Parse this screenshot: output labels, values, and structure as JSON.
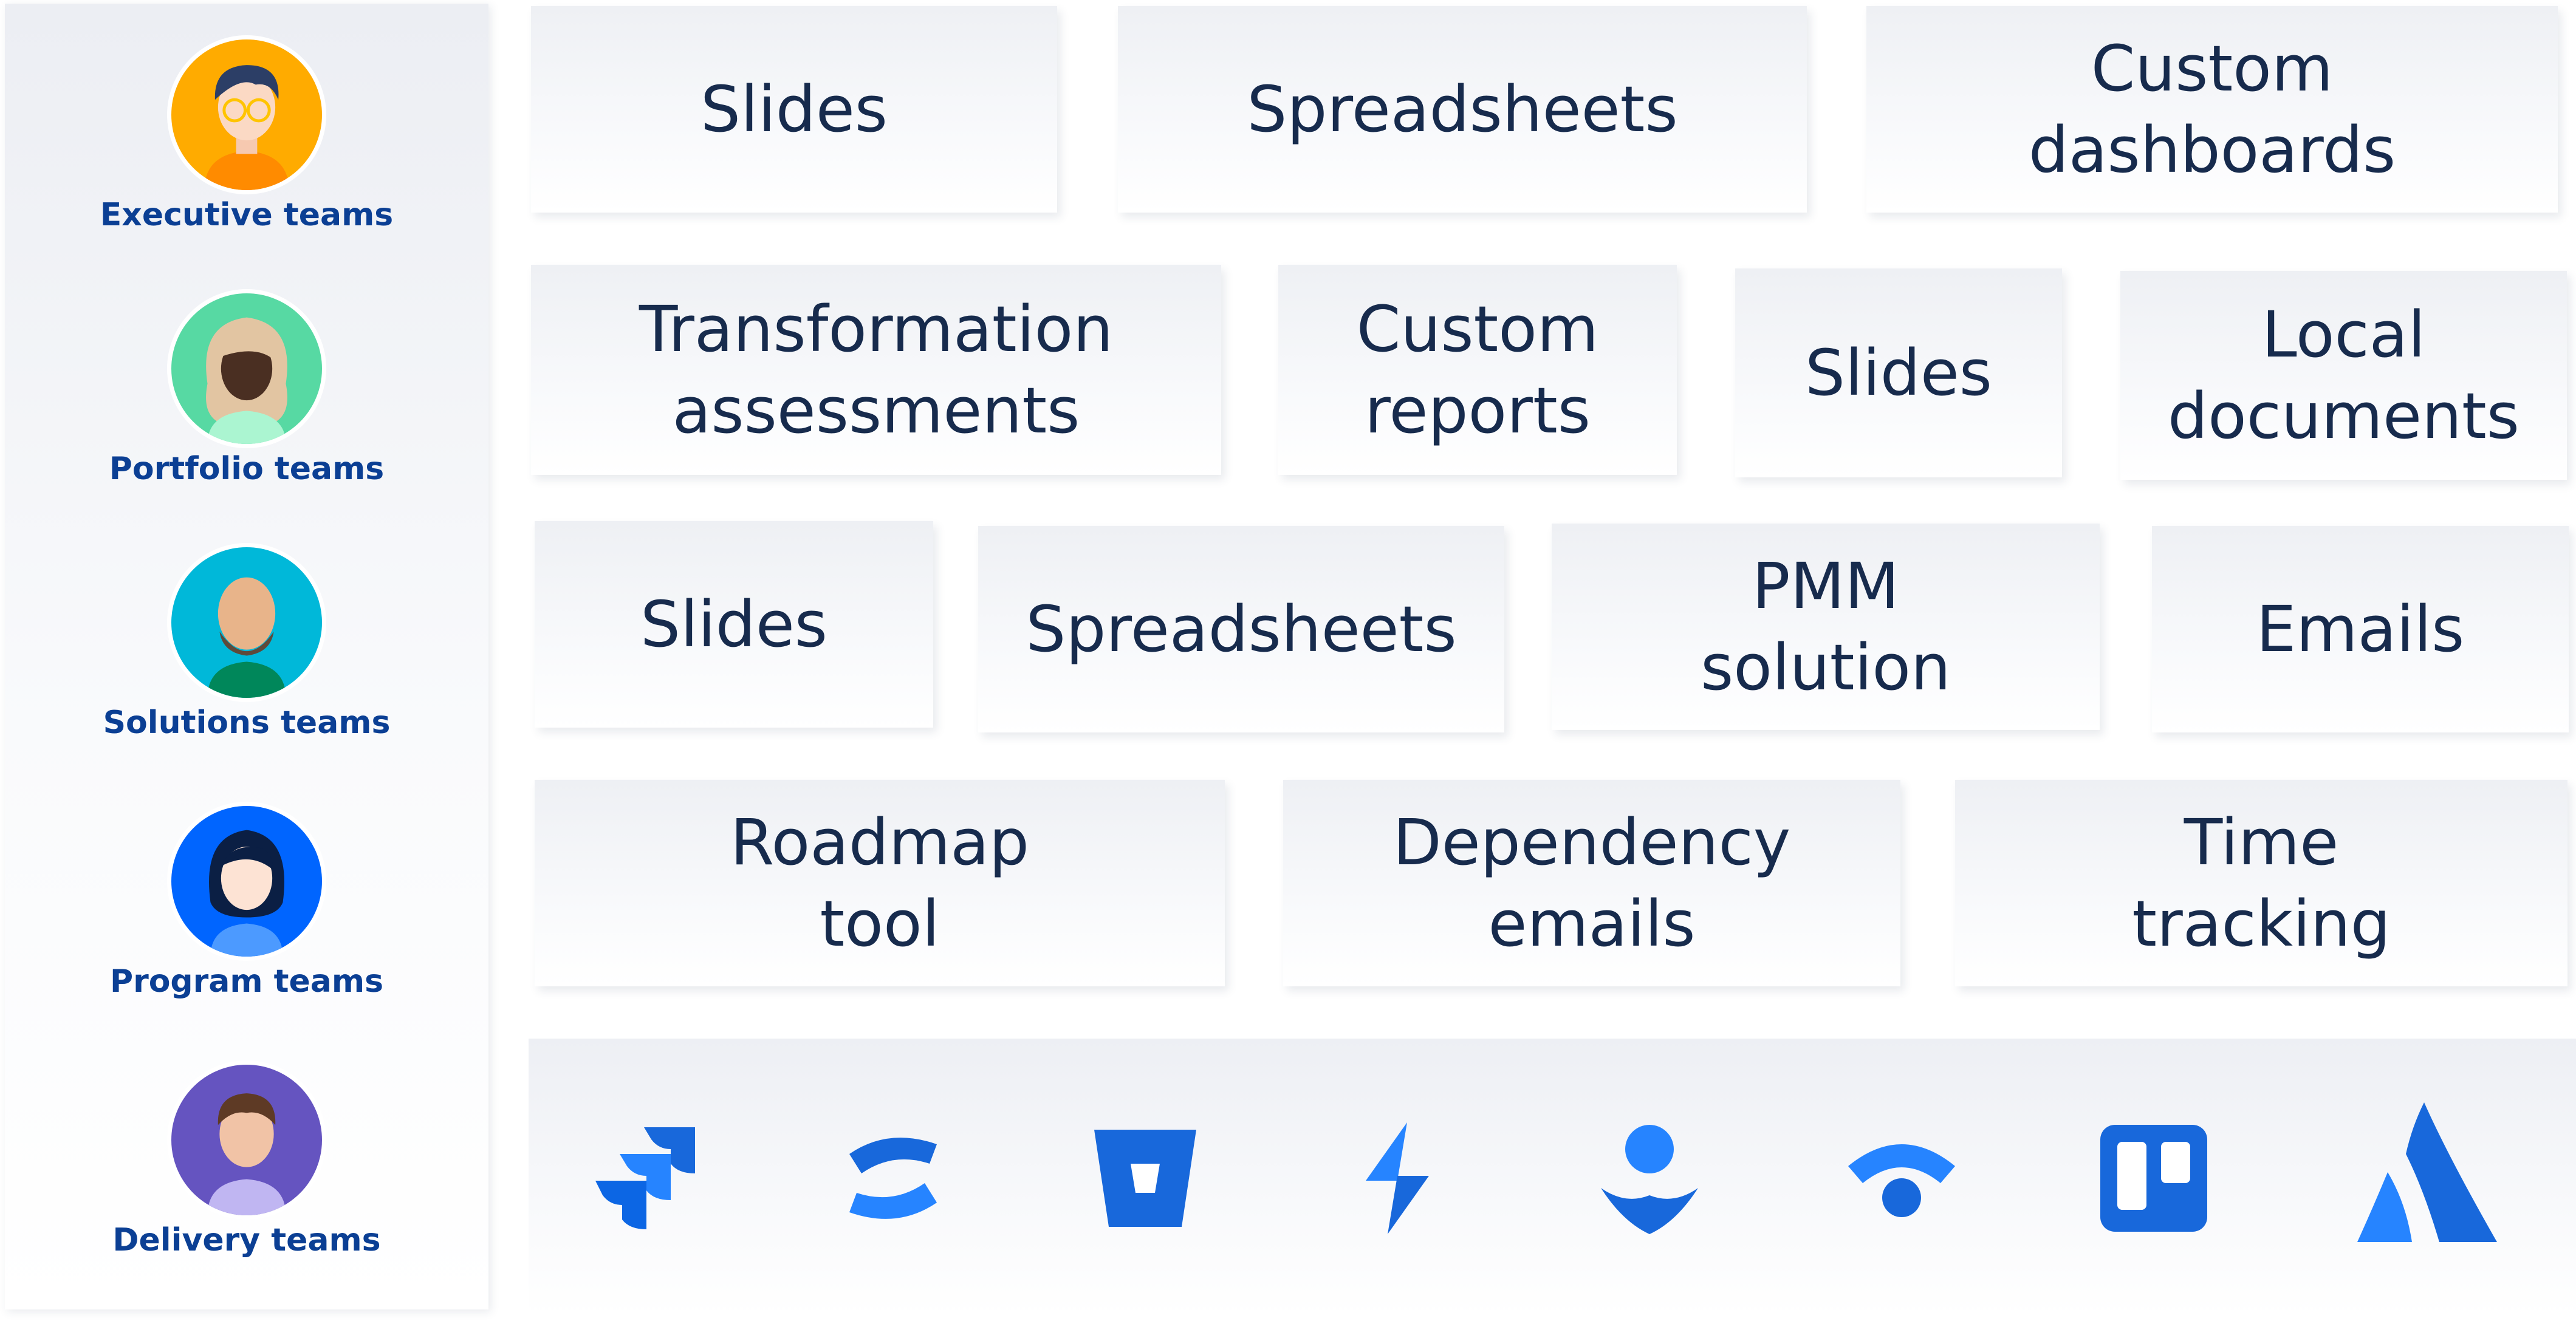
{
  "teams": [
    {
      "label": "Executive teams",
      "avatar_color": "#ffab00"
    },
    {
      "label": "Portfolio teams",
      "avatar_color": "#57d9a3"
    },
    {
      "label": "Solutions teams",
      "avatar_color": "#00b8d9"
    },
    {
      "label": "Program teams",
      "avatar_color": "#0065ff"
    },
    {
      "label": "Delivery teams",
      "avatar_color": "#6554c0"
    }
  ],
  "rows": [
    {
      "cards": [
        {
          "text": "Slides"
        },
        {
          "text": "Spreadsheets"
        },
        {
          "text": "Custom\ndashboards"
        }
      ]
    },
    {
      "cards": [
        {
          "text": "Transformation\nassessments"
        },
        {
          "text": "Custom\nreports"
        },
        {
          "text": "Slides"
        },
        {
          "text": "Local\ndocuments"
        }
      ]
    },
    {
      "cards": [
        {
          "text": "Slides"
        },
        {
          "text": "Spreadsheets"
        },
        {
          "text": "PMM\nsolution"
        },
        {
          "text": "Emails"
        }
      ]
    },
    {
      "cards": [
        {
          "text": "Roadmap\ntool"
        },
        {
          "text": "Dependency\nemails"
        },
        {
          "text": "Time\ntracking"
        }
      ]
    }
  ],
  "products": {
    "accent_color": "#1868db",
    "icons": [
      "jira-software-icon",
      "confluence-icon",
      "bitbucket-icon",
      "jira-service-management-icon",
      "opsgenie-icon",
      "statuspage-icon",
      "trello-icon",
      "atlassian-icon"
    ]
  },
  "colors": {
    "text_dark": "#172b4d",
    "team_label": "#0b3f94"
  }
}
